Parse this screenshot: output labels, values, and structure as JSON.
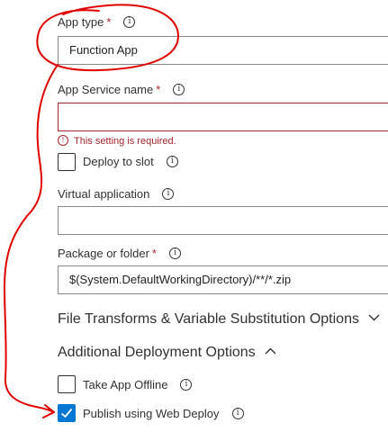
{
  "app_type": {
    "label": "App type",
    "required_mark": "*",
    "value": "Function App"
  },
  "app_service_name": {
    "label": "App Service name",
    "required_mark": "*",
    "value": "",
    "error": "This setting is required."
  },
  "deploy_to_slot": {
    "label": "Deploy to slot",
    "checked": false
  },
  "virtual_application": {
    "label": "Virtual application",
    "value": ""
  },
  "package_or_folder": {
    "label": "Package or folder",
    "required_mark": "*",
    "value": "$(System.DefaultWorkingDirectory)/**/*.zip"
  },
  "file_transforms": {
    "label": "File Transforms & Variable Substitution Options",
    "expanded": false
  },
  "additional_deployment": {
    "label": "Additional Deployment Options",
    "expanded": true
  },
  "take_app_offline": {
    "label": "Take App Offline",
    "checked": false
  },
  "publish_web_deploy": {
    "label": "Publish using Web Deploy",
    "checked": true
  },
  "colors": {
    "accent": "#0078d4",
    "error": "#a4262c",
    "annotation": "#e00000"
  },
  "icons": {
    "info": "info-icon",
    "error": "error-icon",
    "chevron_down": "chevron-down-icon",
    "chevron_up": "chevron-up-icon",
    "checkmark": "checkmark-icon"
  }
}
